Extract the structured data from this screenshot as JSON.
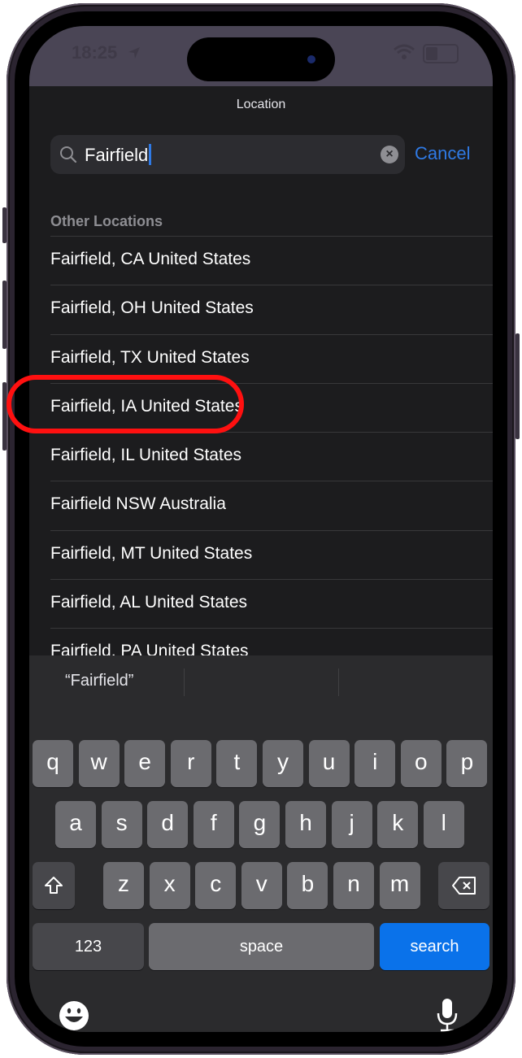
{
  "status_bar": {
    "time": "18:25"
  },
  "sheet": {
    "title": "Location",
    "search": {
      "value": "Fairfield",
      "cancel_label": "Cancel"
    },
    "section_header": "Other Locations",
    "results": [
      "Fairfield, CA United States",
      "Fairfield, OH United States",
      "Fairfield, TX United States",
      "Fairfield, IA United States",
      "Fairfield, IL United States",
      "Fairfield NSW Australia",
      "Fairfield, MT United States",
      "Fairfield, AL United States",
      "Fairfield, PA United States"
    ],
    "highlighted_result": "Fairfield, IA United States",
    "highlight_color": "#ff1010"
  },
  "keyboard": {
    "suggestion": "“Fairfield”",
    "row1": [
      "q",
      "w",
      "e",
      "r",
      "t",
      "y",
      "u",
      "i",
      "o",
      "p"
    ],
    "row2": [
      "a",
      "s",
      "d",
      "f",
      "g",
      "h",
      "j",
      "k",
      "l"
    ],
    "row3": [
      "z",
      "x",
      "c",
      "v",
      "b",
      "n",
      "m"
    ],
    "numbers_label": "123",
    "space_label": "space",
    "action_label": "search",
    "action_color": "#0a72ea"
  },
  "colors": {
    "accent": "#2f7ae5",
    "background": "#1c1c1e"
  }
}
